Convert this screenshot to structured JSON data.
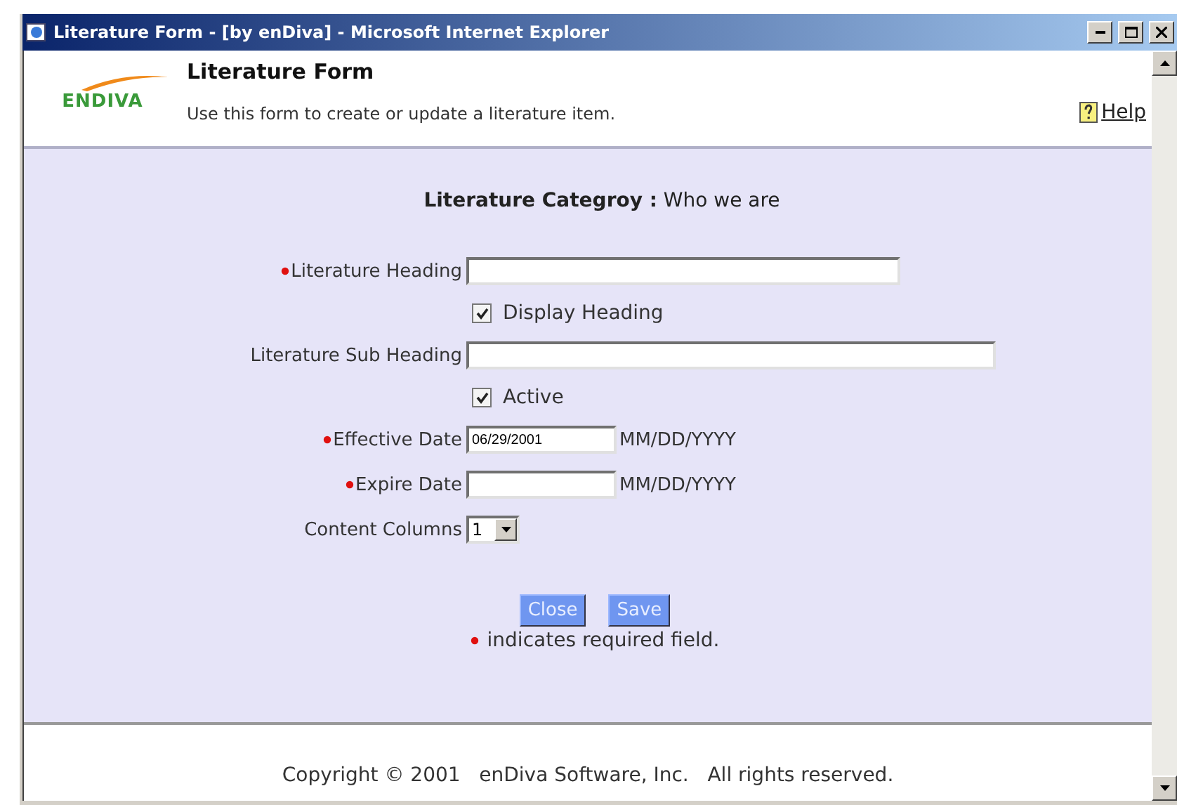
{
  "window": {
    "title": "Literature Form - [by enDiva] - Microsoft Internet Explorer"
  },
  "header": {
    "logo": "ENDIVA",
    "title": "Literature Form",
    "subtitle": "Use this form to create or update a literature item.",
    "help": "Help"
  },
  "form": {
    "category_label": "Literature Categroy :",
    "category_value": "Who we are",
    "fields": [
      {
        "kind": "text",
        "label": "Literature Heading",
        "required": true,
        "wide": false
      },
      {
        "kind": "checkbox",
        "label": "Display Heading",
        "checked": true
      },
      {
        "kind": "text",
        "label": "Literature Sub Heading",
        "required": false,
        "wide": true
      },
      {
        "kind": "checkbox",
        "label": "Active",
        "checked": true
      },
      {
        "kind": "date",
        "label": "Effective Date",
        "required": true,
        "value": "06/29/2001",
        "format": "MM/DD/YYYY"
      },
      {
        "kind": "date",
        "label": "Expire Date",
        "required": true,
        "format": "MM/DD/YYYY"
      },
      {
        "kind": "select",
        "label": "Content Columns",
        "required": false,
        "value": "1"
      }
    ],
    "buttons": [
      "Close",
      "Save"
    ],
    "required_note": "indicates required field."
  },
  "footer": {
    "copyright": "Copyright © 2001   enDiva Software, Inc.   All rights reserved."
  }
}
